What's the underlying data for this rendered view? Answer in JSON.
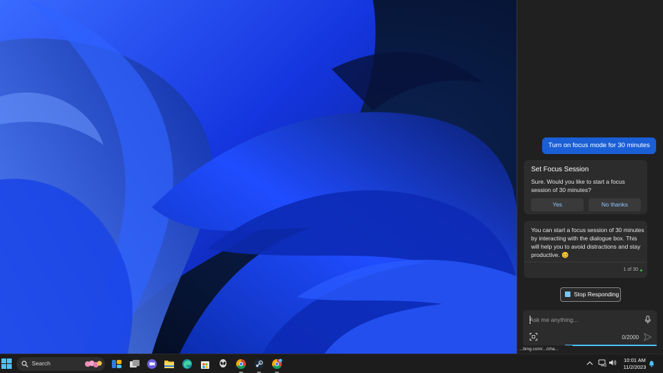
{
  "copilot": {
    "user_message": "Turn on focus mode for 30 minutes",
    "focus_card": {
      "title": "Set Focus Session",
      "body": "Sure. Would you like to start a focus session of 30 minutes?",
      "yes_label": "Yes",
      "no_label": "No thanks"
    },
    "response": {
      "body": "You can start a focus session of 30 minutes by interacting with the dialogue box. This will help you to avoid distractions and stay productive. 😊",
      "counter": "1 of 30"
    },
    "stop_label": "Stop Responding",
    "input": {
      "placeholder": "Ask me anything...",
      "char_count": "0/2000"
    },
    "status_url": "...bing.com/.../cha..."
  },
  "taskbar": {
    "search_label": "Search",
    "clock_time": "10:01 AM",
    "clock_date": "11/2/2023",
    "icons": [
      "windows-start-icon",
      "search-icon",
      "widgets-icon",
      "task-view-icon",
      "teams-chat-icon",
      "file-explorer-icon",
      "edge-icon",
      "microsoft-store-icon",
      "alienware-icon",
      "chrome-icon",
      "steam-icon",
      "chrome-canary-icon"
    ]
  },
  "colors": {
    "accent": "#1a5fd6",
    "link": "#8fc4ff",
    "progress": "#4cc2ff",
    "panel_bg": "#202020",
    "taskbar_bg": "#1c1c1c"
  }
}
